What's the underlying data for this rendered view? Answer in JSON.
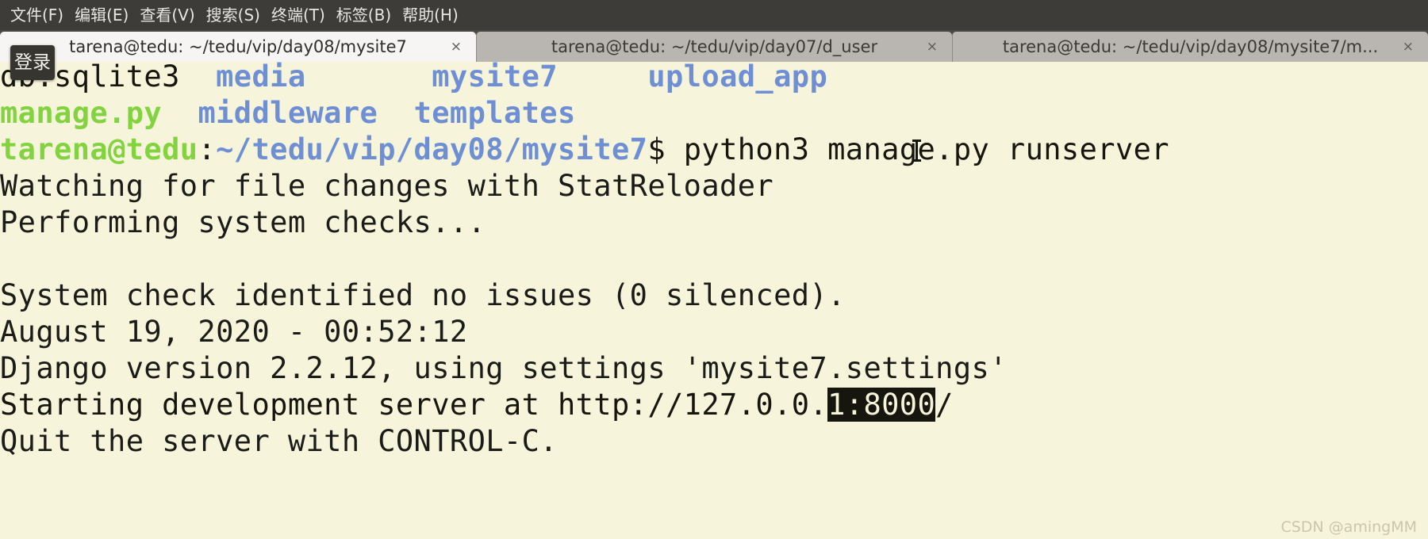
{
  "window": {
    "app": "GNOME Terminal",
    "menubar": {
      "items": [
        {
          "label": "文件(F)"
        },
        {
          "label": "编辑(E)"
        },
        {
          "label": "查看(V)"
        },
        {
          "label": "搜索(S)"
        },
        {
          "label": "终端(T)"
        },
        {
          "label": "标签(B)"
        },
        {
          "label": "帮助(H)"
        }
      ]
    },
    "tabs": [
      {
        "title": "tarena@tedu: ~/tedu/vip/day08/mysite7",
        "close": "×",
        "active": true
      },
      {
        "title": "tarena@tedu: ~/tedu/vip/day07/d_user",
        "close": "×",
        "active": false
      },
      {
        "title": "tarena@tedu: ~/tedu/vip/day08/mysite7/m...",
        "close": "×",
        "active": false
      }
    ]
  },
  "overlay": {
    "login_badge": "登录"
  },
  "terminal": {
    "colors": {
      "background": "#f7f4dc",
      "foreground": "#16160f",
      "directory_blue": "#6f8fd4",
      "executable_green": "#83d340",
      "selection_bg": "#16160f",
      "selection_fg": "#f7f4dc"
    },
    "listing": {
      "row1": {
        "file_db": "db.sqlite3",
        "dir_media": "media",
        "dir_mysite7": "mysite7",
        "dir_upload_app": "upload_app"
      },
      "row2": {
        "exec_manage": "manage.py",
        "dir_middleware": "middleware",
        "dir_templates": "templates"
      }
    },
    "prompt": {
      "user_host": "tarena@tedu",
      "separator": ":",
      "path": "~/tedu/vip/day08/mysite7",
      "sigil": "$",
      "command": " python3 manage.py runserver"
    },
    "output": {
      "line1": "Watching for file changes with StatReloader",
      "line2": "Performing system checks...",
      "line3": "",
      "line4": "System check identified no issues (0 silenced).",
      "line5": "August 19, 2020 - 00:52:12",
      "line6": "Django version 2.2.12, using settings 'mysite7.settings'",
      "line7_pre": "Starting development server at http://127.0.0.",
      "line7_selected": "1:8000",
      "line7_post": "/",
      "line8": "Quit the server with CONTROL-C."
    }
  },
  "watermark": "CSDN @amingMM"
}
